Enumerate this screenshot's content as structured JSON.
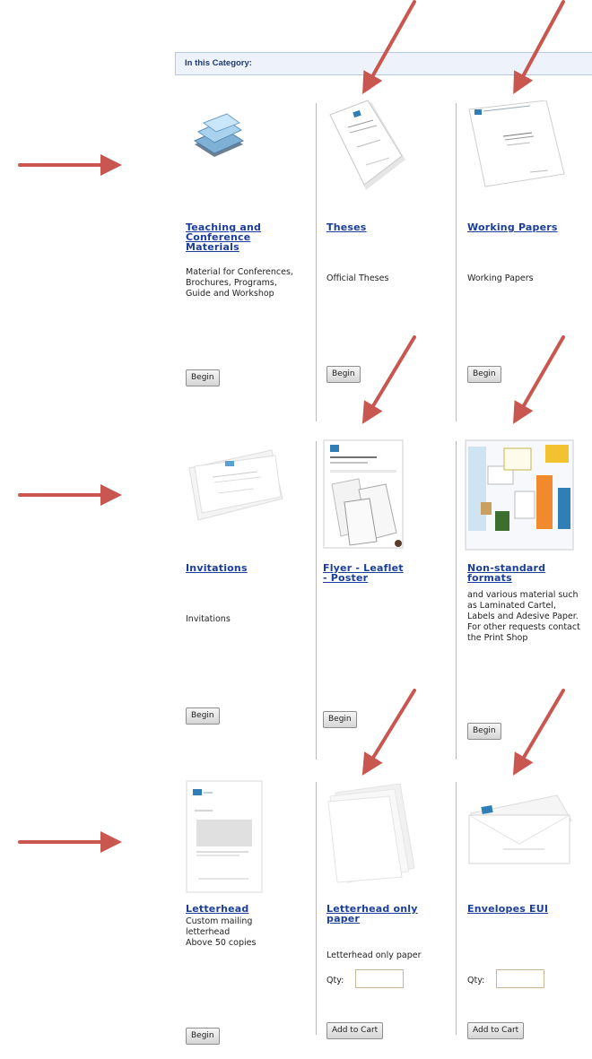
{
  "header": {
    "label": "In this Category:"
  },
  "items": [
    {
      "title": "Teaching and Conference Materials",
      "description": "Material for Conferences, Brochures, Programs, Guide and Workshop",
      "button": "Begin"
    },
    {
      "title": "Theses",
      "description": "Official Theses",
      "button": "Begin"
    },
    {
      "title": "Working Papers",
      "description": "Working Papers",
      "button": "Begin"
    },
    {
      "title": "Invitations",
      "description": "Invitations",
      "button": "Begin"
    },
    {
      "title": "Flyer - Leaflet - Poster",
      "description": "",
      "button": "Begin"
    },
    {
      "title": "Non-standard formats",
      "description": "and various material such as Laminated Cartel, Labels and Adesive Paper. For other requests contact the Print Shop",
      "button": "Begin"
    },
    {
      "title": "Letterhead",
      "description": "Custom mailing letterhead\nAbove 50 copies",
      "button": "Begin"
    },
    {
      "title": "Letterhead only paper",
      "description": "Letterhead only paper",
      "qty_label": "Qty:",
      "qty_value": "",
      "button": "Add to Cart"
    },
    {
      "title": "Envelopes EUI",
      "description": "",
      "qty_label": "Qty:",
      "qty_value": "",
      "button": "Add to Cart"
    }
  ],
  "colors": {
    "arrow": "#c9574f",
    "link": "#1b3e9b",
    "header_bg": "#eef3fb"
  }
}
